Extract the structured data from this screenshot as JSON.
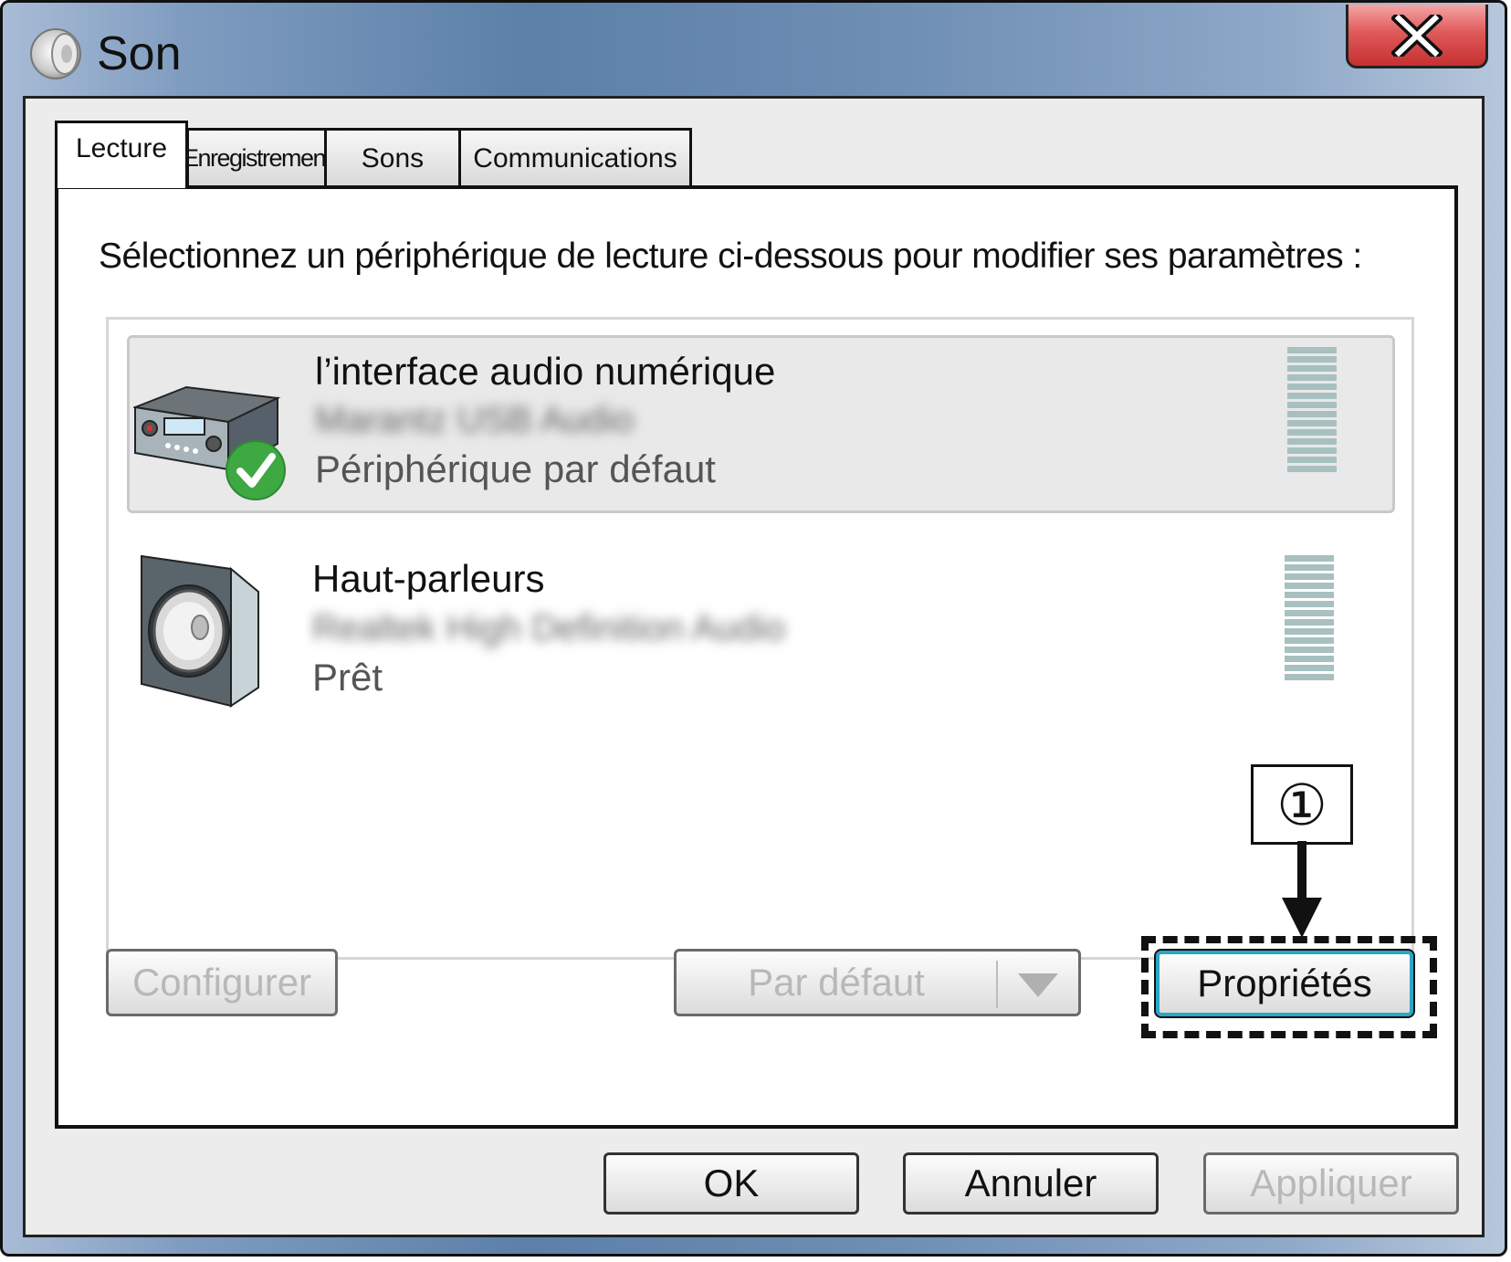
{
  "window": {
    "title": "Son",
    "close_label": "X"
  },
  "tabs": [
    {
      "label": "Lecture",
      "active": true
    },
    {
      "label": "Enregistrement",
      "active": false
    },
    {
      "label": "Sons",
      "active": false
    },
    {
      "label": "Communications",
      "active": false
    }
  ],
  "instruction": "Sélectionnez un périphérique de lecture ci-dessous pour modifier ses paramètres :",
  "devices": [
    {
      "name": "l’interface audio numérique",
      "sub": "Marantz USB Audio",
      "status": "Périphérique par défaut",
      "selected": true,
      "default": true,
      "icon": "audio-interface-icon"
    },
    {
      "name": "Haut-parleurs",
      "sub": "Realtek High Definition Audio",
      "status": "Prêt",
      "selected": false,
      "default": false,
      "icon": "speaker-icon"
    }
  ],
  "buttons": {
    "configure": "Configurer",
    "set_default": "Par défaut",
    "properties": "Propriétés",
    "ok": "OK",
    "cancel": "Annuler",
    "apply": "Appliquer"
  },
  "callout": {
    "label": "①"
  },
  "colors": {
    "default_check": "#3ea843",
    "properties_focus": "#29a6c8",
    "meter": "#a8c0c0",
    "close_button": "#d94848"
  }
}
